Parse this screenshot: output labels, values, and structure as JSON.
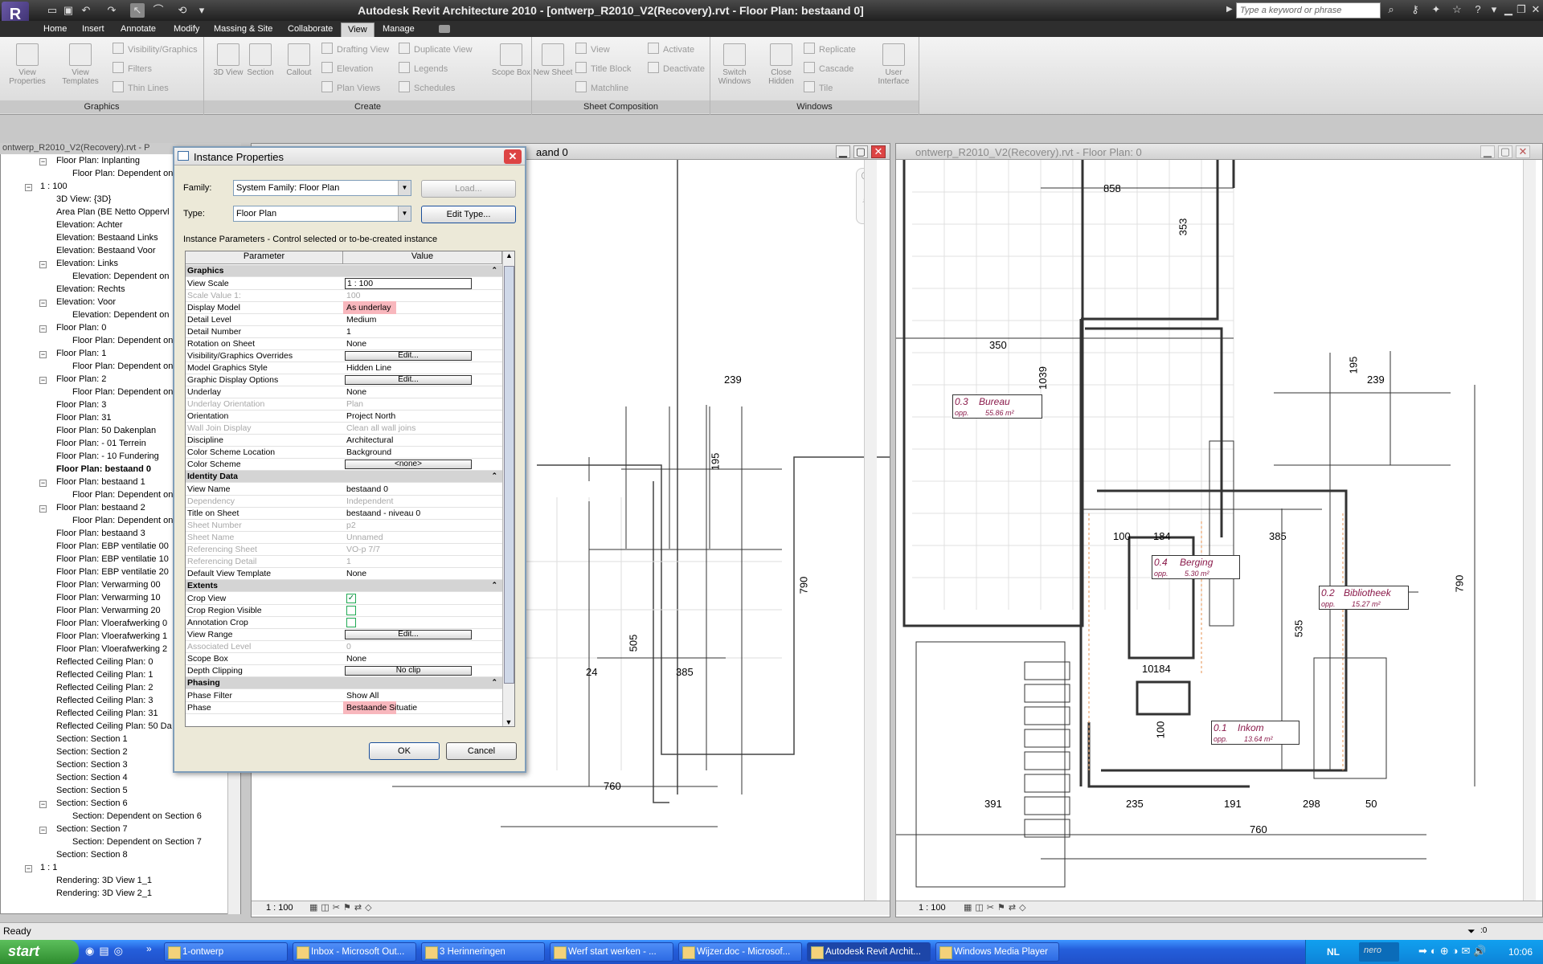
{
  "app": {
    "logo": "R",
    "title": "Autodesk Revit Architecture 2010 - [ontwerp_R2010_V2(Recovery).rvt - Floor Plan: bestaand 0]",
    "search_placeholder": "Type a keyword or phrase"
  },
  "ribbon_tabs": [
    "Home",
    "Insert",
    "Annotate",
    "Modify",
    "Massing & Site",
    "Collaborate",
    "View",
    "Manage"
  ],
  "ribbon": {
    "graphics": {
      "title": "Graphics",
      "view_properties": "View Properties",
      "view_templates": "View Templates",
      "visibility_graphics": "Visibility/Graphics",
      "filters": "Filters",
      "thin_lines": "Thin Lines"
    },
    "create": {
      "title": "Create",
      "view_3d": "3D View",
      "section": "Section",
      "callout": "Callout",
      "drafting_view": "Drafting View",
      "elevation": "Elevation",
      "plan_views": "Plan Views",
      "duplicate_view": "Duplicate View",
      "legends": "Legends",
      "schedules": "Schedules",
      "scope_box": "Scope Box"
    },
    "sheet": {
      "title": "Sheet Composition",
      "new_sheet": "New Sheet",
      "view": "View",
      "title_block": "Title Block",
      "matchline": "Matchline",
      "activate": "Activate",
      "deactivate": "Deactivate"
    },
    "windows": {
      "title": "Windows",
      "switch_windows": "Switch Windows",
      "close_hidden": "Close Hidden",
      "replicate": "Replicate",
      "cascade": "Cascade",
      "tile": "Tile",
      "user_interface": "User Interface"
    }
  },
  "browser": {
    "title": "ontwerp_R2010_V2(Recovery).rvt - P",
    "items": [
      {
        "label": "Floor Plan: Inplanting",
        "level": 2,
        "toggle": "-"
      },
      {
        "label": "Floor Plan: Dependent on",
        "level": 3
      },
      {
        "label": "1 : 100",
        "level": 1,
        "toggle": "-"
      },
      {
        "label": "3D View: {3D}",
        "level": 2
      },
      {
        "label": "Area Plan (BE Netto Oppervl",
        "level": 2
      },
      {
        "label": "Elevation: Achter",
        "level": 2
      },
      {
        "label": "Elevation: Bestaand Links",
        "level": 2
      },
      {
        "label": "Elevation: Bestaand Voor",
        "level": 2
      },
      {
        "label": "Elevation: Links",
        "level": 2,
        "toggle": "-"
      },
      {
        "label": "Elevation: Dependent on",
        "level": 3
      },
      {
        "label": "Elevation: Rechts",
        "level": 2
      },
      {
        "label": "Elevation: Voor",
        "level": 2,
        "toggle": "-"
      },
      {
        "label": "Elevation: Dependent on",
        "level": 3
      },
      {
        "label": "Floor Plan: 0",
        "level": 2,
        "toggle": "-"
      },
      {
        "label": "Floor Plan: Dependent on",
        "level": 3
      },
      {
        "label": "Floor Plan: 1",
        "level": 2,
        "toggle": "-"
      },
      {
        "label": "Floor Plan: Dependent on",
        "level": 3
      },
      {
        "label": "Floor Plan: 2",
        "level": 2,
        "toggle": "-"
      },
      {
        "label": "Floor Plan: Dependent on",
        "level": 3
      },
      {
        "label": "Floor Plan: 3",
        "level": 2
      },
      {
        "label": "Floor Plan: 31",
        "level": 2
      },
      {
        "label": "Floor Plan: 50 Dakenplan",
        "level": 2
      },
      {
        "label": "Floor Plan: - 01 Terrein",
        "level": 2
      },
      {
        "label": "Floor Plan: - 10 Fundering",
        "level": 2
      },
      {
        "label": "Floor Plan: bestaand 0",
        "level": 2,
        "bold": true
      },
      {
        "label": "Floor Plan: bestaand 1",
        "level": 2,
        "toggle": "-"
      },
      {
        "label": "Floor Plan: Dependent on",
        "level": 3
      },
      {
        "label": "Floor Plan: bestaand 2",
        "level": 2,
        "toggle": "-"
      },
      {
        "label": "Floor Plan: Dependent on",
        "level": 3
      },
      {
        "label": "Floor Plan: bestaand 3",
        "level": 2
      },
      {
        "label": "Floor Plan: EBP ventilatie 00",
        "level": 2
      },
      {
        "label": "Floor Plan: EBP ventilatie 10",
        "level": 2
      },
      {
        "label": "Floor Plan: EBP ventilatie 20",
        "level": 2
      },
      {
        "label": "Floor Plan: Verwarming 00",
        "level": 2
      },
      {
        "label": "Floor Plan: Verwarming 10",
        "level": 2
      },
      {
        "label": "Floor Plan: Verwarming 20",
        "level": 2
      },
      {
        "label": "Floor Plan: Vloerafwerking 0",
        "level": 2
      },
      {
        "label": "Floor Plan: Vloerafwerking 1",
        "level": 2
      },
      {
        "label": "Floor Plan: Vloerafwerking 2",
        "level": 2
      },
      {
        "label": "Reflected Ceiling Plan: 0",
        "level": 2
      },
      {
        "label": "Reflected Ceiling Plan: 1",
        "level": 2
      },
      {
        "label": "Reflected Ceiling Plan: 2",
        "level": 2
      },
      {
        "label": "Reflected Ceiling Plan: 3",
        "level": 2
      },
      {
        "label": "Reflected Ceiling Plan: 31",
        "level": 2
      },
      {
        "label": "Reflected Ceiling Plan: 50 Da",
        "level": 2
      },
      {
        "label": "Section: Section 1",
        "level": 2
      },
      {
        "label": "Section: Section 2",
        "level": 2
      },
      {
        "label": "Section: Section 3",
        "level": 2
      },
      {
        "label": "Section: Section 4",
        "level": 2
      },
      {
        "label": "Section: Section 5",
        "level": 2
      },
      {
        "label": "Section: Section 6",
        "level": 2,
        "toggle": "-"
      },
      {
        "label": "Section: Dependent on Section 6",
        "level": 3
      },
      {
        "label": "Section: Section 7",
        "level": 2,
        "toggle": "-"
      },
      {
        "label": "Section: Dependent on Section 7",
        "level": 3
      },
      {
        "label": "Section: Section 8",
        "level": 2
      },
      {
        "label": "1 : 1",
        "level": 1,
        "toggle": "-"
      },
      {
        "label": "Rendering: 3D View 1_1",
        "level": 2
      },
      {
        "label": "Rendering: 3D View 2_1",
        "level": 2
      }
    ]
  },
  "view_left": {
    "title": "aand 0",
    "scale": "1 : 100",
    "dims": [
      "195",
      "239",
      "790",
      "505",
      "24",
      "385",
      "760"
    ]
  },
  "view_right": {
    "title": "ontwerp_R2010_V2(Recovery).rvt - Floor Plan: 0",
    "scale": "1 : 100",
    "dims": [
      "858",
      "353",
      "350",
      "1039",
      "195",
      "239",
      "100",
      "184",
      "385",
      "535",
      "10",
      "184",
      "100",
      "391",
      "235",
      "191",
      "298",
      "50",
      "760",
      "790"
    ],
    "rooms": [
      {
        "num": "0.3",
        "name": "Bureau",
        "area_label": "opp.",
        "area": "55.86 m²"
      },
      {
        "num": "0.4",
        "name": "Berging",
        "area_label": "opp.",
        "area": "5.30 m²"
      },
      {
        "num": "0.2",
        "name": "Bibliotheek",
        "area_label": "opp.",
        "area": "15.27 m²"
      },
      {
        "num": "0.1",
        "name": "Inkom",
        "area_label": "opp.",
        "area": "13.64 m²"
      }
    ]
  },
  "dialog": {
    "title": "Instance Properties",
    "family_label": "Family:",
    "family_value": "System Family: Floor Plan",
    "load_btn": "Load...",
    "type_label": "Type:",
    "type_value": "Floor Plan",
    "edit_type_btn": "Edit Type...",
    "caption": "Instance Parameters - Control selected or to-be-created instance",
    "col_param": "Parameter",
    "col_value": "Value",
    "ok": "OK",
    "cancel": "Cancel",
    "rows": [
      {
        "group": "Graphics"
      },
      {
        "p": "View Scale",
        "v": "1 : 100",
        "input": true
      },
      {
        "p": "Scale Value    1:",
        "v": "100",
        "dis": true
      },
      {
        "p": "Display Model",
        "v": "As underlay",
        "hl": true
      },
      {
        "p": "Detail Level",
        "v": "Medium"
      },
      {
        "p": "Detail Number",
        "v": "1"
      },
      {
        "p": "Rotation on Sheet",
        "v": "None"
      },
      {
        "p": "Visibility/Graphics Overrides",
        "v": "Edit...",
        "btn": true
      },
      {
        "p": "Model Graphics Style",
        "v": "Hidden Line"
      },
      {
        "p": "Graphic Display Options",
        "v": "Edit...",
        "btn": true
      },
      {
        "p": "Underlay",
        "v": "None"
      },
      {
        "p": "Underlay Orientation",
        "v": "Plan",
        "dis": true
      },
      {
        "p": "Orientation",
        "v": "Project North"
      },
      {
        "p": "Wall Join Display",
        "v": "Clean all wall joins",
        "dis": true
      },
      {
        "p": "Discipline",
        "v": "Architectural"
      },
      {
        "p": "Color Scheme Location",
        "v": "Background"
      },
      {
        "p": "Color Scheme",
        "v": "<none>",
        "btn": true
      },
      {
        "group": "Identity Data"
      },
      {
        "p": "View Name",
        "v": "bestaand 0"
      },
      {
        "p": "Dependency",
        "v": "Independent",
        "dis": true
      },
      {
        "p": "Title on Sheet",
        "v": "bestaand - niveau 0"
      },
      {
        "p": "Sheet Number",
        "v": "p2",
        "dis": true
      },
      {
        "p": "Sheet Name",
        "v": "Unnamed",
        "dis": true
      },
      {
        "p": "Referencing Sheet",
        "v": "VO-p 7/7",
        "dis": true
      },
      {
        "p": "Referencing Detail",
        "v": "1",
        "dis": true
      },
      {
        "p": "Default View Template",
        "v": "None"
      },
      {
        "group": "Extents"
      },
      {
        "p": "Crop View",
        "check": true
      },
      {
        "p": "Crop Region Visible",
        "check": false
      },
      {
        "p": "Annotation Crop",
        "check": false
      },
      {
        "p": "View Range",
        "v": "Edit...",
        "btn": true
      },
      {
        "p": "Associated Level",
        "v": "0",
        "dis": true
      },
      {
        "p": "Scope Box",
        "v": "None"
      },
      {
        "p": "Depth Clipping",
        "v": "No clip",
        "btn": true
      },
      {
        "group": "Phasing"
      },
      {
        "p": "Phase Filter",
        "v": "Show All"
      },
      {
        "p": "Phase",
        "v": "Bestaande Situatie",
        "hl": true
      }
    ]
  },
  "status": {
    "text": "Ready",
    "filter_count": ":0"
  },
  "taskbar": {
    "start": "start",
    "items": [
      "1-ontwerp",
      "Inbox - Microsoft Out...",
      "3 Herinneringen",
      "Werf start werken - ...",
      "Wijzer.doc - Microsof...",
      "Autodesk Revit Archit...",
      "Windows Media Player"
    ],
    "active_index": 5,
    "lang": "NL",
    "clock": "10:06",
    "tray_brand": "nero"
  }
}
